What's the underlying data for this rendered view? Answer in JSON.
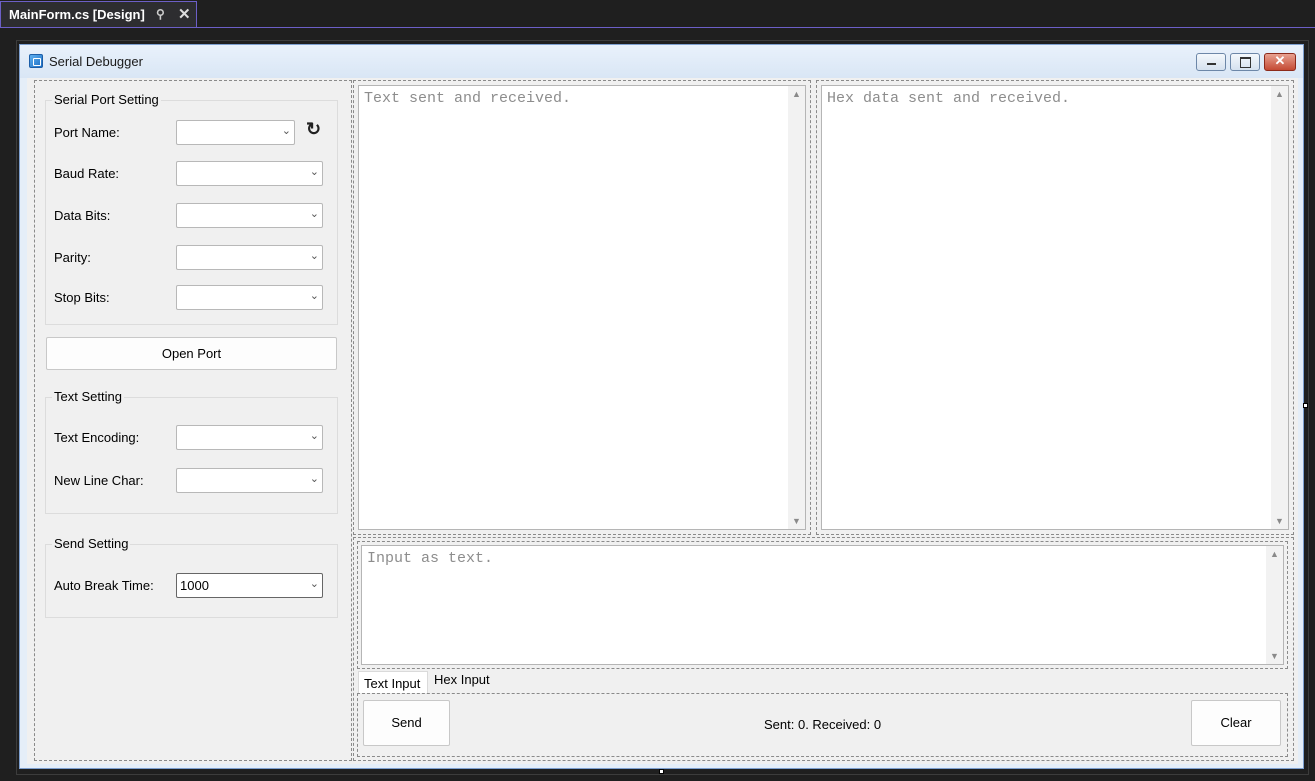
{
  "ide": {
    "tab_title": "MainForm.cs [Design]",
    "pin_icon": "pin-icon",
    "close_icon": "close-icon"
  },
  "form": {
    "title": "Serial Debugger",
    "window_buttons": {
      "close_glyph": "✕"
    }
  },
  "serial_port_setting": {
    "title": "Serial Port Setting",
    "port_name_label": "Port Name:",
    "baud_rate_label": "Baud Rate:",
    "data_bits_label": "Data Bits:",
    "parity_label": "Parity:",
    "stop_bits_label": "Stop Bits:",
    "port_name_value": "",
    "baud_rate_value": "",
    "data_bits_value": "",
    "parity_value": "",
    "stop_bits_value": ""
  },
  "open_port_label": "Open Port",
  "text_setting": {
    "title": "Text Setting",
    "text_encoding_label": "Text Encoding:",
    "new_line_char_label": "New Line Char:",
    "text_encoding_value": "",
    "new_line_char_value": ""
  },
  "send_setting": {
    "title": "Send Setting",
    "auto_break_time_label": "Auto Break Time:",
    "auto_break_time_value": "1000"
  },
  "text_output": {
    "placeholder": "Text sent and received."
  },
  "hex_output": {
    "placeholder": "Hex data sent and received."
  },
  "input": {
    "placeholder": "Input as text."
  },
  "input_tabs": [
    "Text Input",
    "Hex Input"
  ],
  "send_label": "Send",
  "clear_label": "Clear",
  "status": "Sent: 0. Received: 0"
}
